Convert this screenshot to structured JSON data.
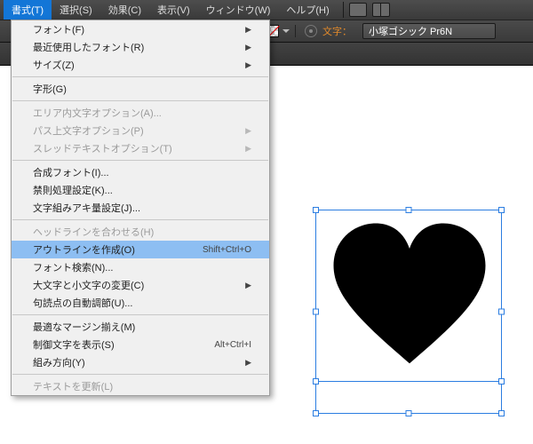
{
  "menubar": {
    "items": [
      {
        "label": "書式(T)"
      },
      {
        "label": "選択(S)"
      },
      {
        "label": "効果(C)"
      },
      {
        "label": "表示(V)"
      },
      {
        "label": "ウィンドウ(W)"
      },
      {
        "label": "ヘルプ(H)"
      }
    ]
  },
  "toolbar": {
    "text_label": "文字：",
    "font_name": "小塚ゴシック Pr6N"
  },
  "dropdown": {
    "groups": [
      [
        {
          "label": "フォント(F)",
          "sub": true
        },
        {
          "label": "最近使用したフォント(R)",
          "sub": true
        },
        {
          "label": "サイズ(Z)",
          "sub": true
        }
      ],
      [
        {
          "label": "字形(G)"
        }
      ],
      [
        {
          "label": "エリア内文字オプション(A)...",
          "disabled": true
        },
        {
          "label": "パス上文字オプション(P)",
          "sub": true,
          "disabled": true
        },
        {
          "label": "スレッドテキストオプション(T)",
          "sub": true,
          "disabled": true
        }
      ],
      [
        {
          "label": "合成フォント(I)..."
        },
        {
          "label": "禁則処理設定(K)..."
        },
        {
          "label": "文字組みアキ量設定(J)..."
        }
      ],
      [
        {
          "label": "ヘッドラインを合わせる(H)",
          "disabled": true
        },
        {
          "label": "アウトラインを作成(O)",
          "shortcut": "Shift+Ctrl+O",
          "hov": true
        },
        {
          "label": "フォント検索(N)..."
        },
        {
          "label": "大文字と小文字の変更(C)",
          "sub": true
        },
        {
          "label": "句読点の自動調節(U)..."
        }
      ],
      [
        {
          "label": "最適なマージン揃え(M)"
        },
        {
          "label": "制御文字を表示(S)",
          "shortcut": "Alt+Ctrl+I"
        },
        {
          "label": "組み方向(Y)",
          "sub": true
        }
      ],
      [
        {
          "label": "テキストを更新(L)",
          "disabled": true
        }
      ]
    ]
  },
  "canvas": {
    "shape": "heart",
    "fill": "#000000"
  }
}
